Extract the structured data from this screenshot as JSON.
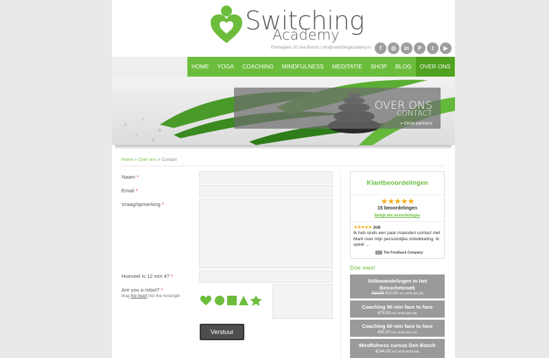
{
  "brand": {
    "title": "Switching",
    "subtitle": "Academy",
    "green": "#6cbd3c",
    "dark_green": "#4fa11f"
  },
  "header": {
    "contact": "Emmaplein 20 Den Bosch  |  info@switchingacademy.nl",
    "social": [
      {
        "icon": "facebook-icon",
        "glyph": "f"
      },
      {
        "icon": "instagram-icon",
        "glyph": "◎"
      },
      {
        "icon": "linkedin-icon",
        "glyph": "in"
      },
      {
        "icon": "pinterest-icon",
        "glyph": "P"
      },
      {
        "icon": "twitter-icon",
        "glyph": "t"
      },
      {
        "icon": "youtube-icon",
        "glyph": "▶"
      }
    ]
  },
  "nav": {
    "items": [
      "HOME",
      "YOGA",
      "COACHING",
      "MINDFULNESS",
      "MEDITATIE",
      "SHOP",
      "BLOG",
      "OVER ONS"
    ],
    "active_index": 7
  },
  "hero": {
    "title": "OVER ONS",
    "subtitle": "CONTACT",
    "link": "» Onze partners"
  },
  "breadcrumb": {
    "home": "Home",
    "sep1": " » ",
    "parent": "Over ons",
    "sep2": " » ",
    "current": "Contact"
  },
  "form": {
    "name_label": "Naam",
    "email_label": "Email",
    "message_label": "Vraag/opmerking",
    "captcha_label": "Hoeveel is 12 min 4?",
    "robot_label": "Are you a robot?",
    "required_mark": "*",
    "robot_note_pre": "drag ",
    "robot_note_link": "the heart",
    "robot_note_post": " into the rectangle",
    "submit_label": "Verstuur"
  },
  "reviews": {
    "title": "Klantbeoordelingen",
    "stars": "★★★★★",
    "count_text": "15 beoordelingen",
    "all_link": "Bekijk alle beoordelingen",
    "reviewer": "Job",
    "text": "Ik heb sinds een paar maanden contact met Mark over mijn persoonlijke ontwikkeling. Ik speel ...",
    "provider": "The Feedback Company",
    "star_color": "#f2b01e"
  },
  "events": {
    "heading": "Doe mee!",
    "items": [
      {
        "title": "Stiltewandelingen In Het Bosschebroek",
        "old_price": "€12,00",
        "price": "€10,00",
        "tax": "incl. BTW (€8,26)"
      },
      {
        "title": "Coaching 90 min face to face",
        "old_price": "",
        "price": "€75,00",
        "tax": "incl. BTW (€61,98)"
      },
      {
        "title": "Coaching 60 min face to face",
        "old_price": "",
        "price": "€50,00",
        "tax": "incl. BTW (€41,32)"
      },
      {
        "title": "Mindfulness cursus Den Bosch",
        "old_price": "",
        "price": "€244,00",
        "tax": "incl. BTW (€201,65)"
      }
    ]
  }
}
